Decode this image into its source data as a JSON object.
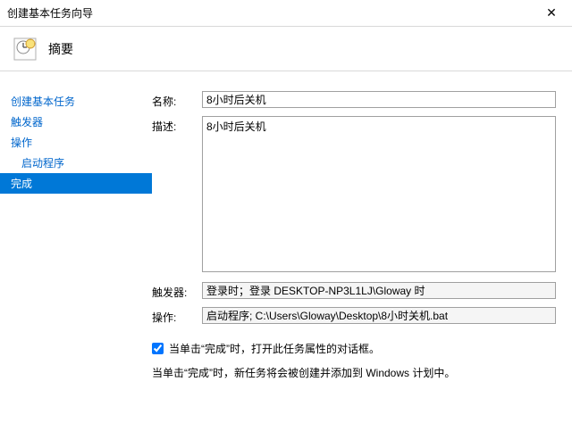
{
  "titlebar": {
    "title": "创建基本任务向导"
  },
  "header": {
    "title": "摘要"
  },
  "sidebar": {
    "items": [
      {
        "label": "创建基本任务"
      },
      {
        "label": "触发器"
      },
      {
        "label": "操作"
      },
      {
        "label": "启动程序"
      },
      {
        "label": "完成"
      }
    ]
  },
  "fields": {
    "name_label": "名称:",
    "name_value": "8小时后关机",
    "desc_label": "描述:",
    "desc_value": "8小时后关机",
    "trigger_label": "触发器:",
    "trigger_value": "登录时；登录 DESKTOP-NP3L1LJ\\Gloway 时",
    "action_label": "操作:",
    "action_value": "启动程序; C:\\Users\\Gloway\\Desktop\\8小时关机.bat"
  },
  "checkbox": {
    "label": "当单击“完成”时，打开此任务属性的对话框。"
  },
  "footer": {
    "info": "当单击“完成”时，新任务将会被创建并添加到 Windows 计划中。"
  }
}
